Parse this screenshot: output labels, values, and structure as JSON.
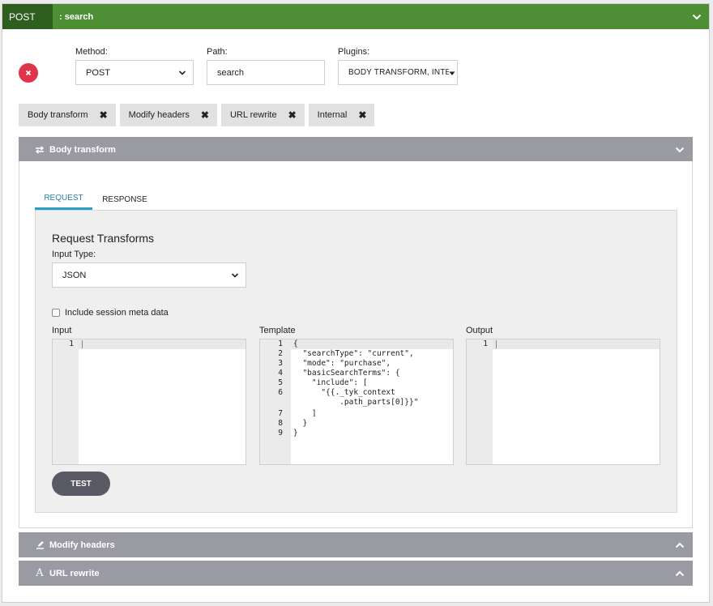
{
  "endpoint": {
    "method": "POST",
    "path_display": ": search"
  },
  "form": {
    "method_label": "Method:",
    "method_value": "POST",
    "path_label": "Path:",
    "path_value": "search",
    "plugins_label": "Plugins:",
    "plugins_value": "BODY TRANSFORM, INTER"
  },
  "tags": [
    {
      "label": "Body transform"
    },
    {
      "label": "Modify headers"
    },
    {
      "label": "URL rewrite"
    },
    {
      "label": "Internal"
    }
  ],
  "sections": {
    "body_transform": {
      "title": "Body transform",
      "icon": "arrows-exchange-icon"
    },
    "modify_headers": {
      "title": "Modify headers",
      "icon": "edit-icon"
    },
    "url_rewrite": {
      "title": "URL rewrite",
      "icon": "font-icon"
    }
  },
  "body_transform": {
    "tabs": [
      {
        "label": "REQUEST",
        "active": true
      },
      {
        "label": "RESPONSE",
        "active": false
      }
    ],
    "panel_title": "Request Transforms",
    "input_type_label": "Input Type:",
    "input_type_value": "JSON",
    "session_meta_label": "Include session meta data",
    "session_meta_checked": false,
    "input_label": "Input",
    "template_label": "Template",
    "output_label": "Output",
    "input_lines": [
      "1"
    ],
    "output_lines": [
      "1"
    ],
    "template_line_numbers": [
      "1",
      "2",
      "3",
      "4",
      "5",
      "6",
      "",
      "7",
      "8",
      "9"
    ],
    "template_code": [
      "{",
      "  \"searchType\": \"current\",",
      "  \"mode\": \"purchase\",",
      "  \"basicSearchTerms\": {",
      "    \"include\": [",
      "      \"{{._tyk_context",
      "          .path_parts[0]}}\"",
      "    ]",
      "  }",
      "}"
    ],
    "test_button": "TEST"
  },
  "colors": {
    "header_green": "#4e8f35",
    "method_badge": "#2d5e1e",
    "remove_red": "#e0344a",
    "accordion_grey": "#9a9aa3",
    "tab_active": "#2b9fc2"
  }
}
